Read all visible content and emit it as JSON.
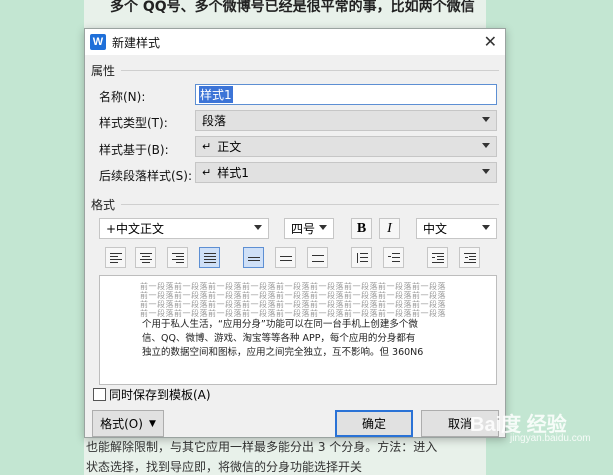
{
  "background_doc": {
    "top_line": "多个 QQ号、多个微博号已经是很平常的事，比如两个微信",
    "bottom_line1": "也能解除限制，与其它应用一样最多能分出 3 个分身。方法：进入",
    "bottom_line2": "状态选择，找到导应即，将微信的分身功能选择开关"
  },
  "watermark": {
    "text": "Bai度 经验",
    "sub": "jingyan.baidu.com"
  },
  "dialog": {
    "app_icon_letter": "W",
    "title": "新建样式",
    "properties": {
      "section_label": "属性",
      "name_label": "名称(N):",
      "name_value": "样式1",
      "type_label": "样式类型(T):",
      "type_value": "段落",
      "based_on_label": "样式基于(B):",
      "based_on_value": "正文",
      "next_label": "后续段落样式(S):",
      "next_value": "样式1"
    },
    "format": {
      "section_label": "格式",
      "font_value": "+中文正文",
      "size_value": "四号",
      "bold": "B",
      "italic": "I",
      "lang_value": "中文"
    },
    "preview": {
      "gray_line": "前一段落前一段落前一段落前一段落前一段落前一段落前一段落前一段落前一段落",
      "main_text_1": "个用于私人生活，“应用分身”功能可以在同一台手机上创建多个微",
      "main_text_2": "信、QQ、微博、游戏、淘宝等等各种 APP，每个应用的分身都有",
      "main_text_3": "独立的数据空间和图标，应用之间完全独立，互不影响。但 360N6"
    },
    "save_to_template": "同时保存到模板(A)",
    "buttons": {
      "format": "格式(O)",
      "ok": "确定",
      "cancel": "取消"
    }
  },
  "colors": {
    "accent": "#2a72d6",
    "selection": "#3c74d7",
    "page_bg": "#c3e6d2"
  }
}
